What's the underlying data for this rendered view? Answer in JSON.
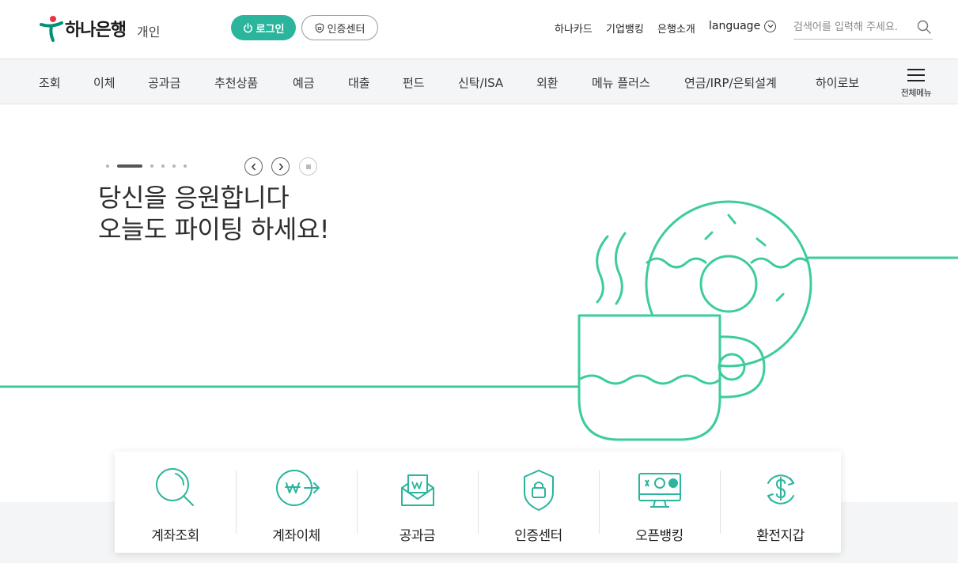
{
  "header": {
    "logo_text": "하나은행",
    "logo_sub": "개인",
    "login_label": "로그인",
    "cert_center_label": "인증센터",
    "util_links": [
      "하나카드",
      "기업뱅킹",
      "은행소개"
    ],
    "language_label": "language",
    "search_placeholder": "검색어를 입력해 주세요."
  },
  "nav": {
    "items": [
      "조회",
      "이체",
      "공과금",
      "추천상품",
      "예금",
      "대출",
      "펀드",
      "신탁/ISA",
      "외환",
      "메뉴 플러스",
      "연금/IRP/은퇴설계",
      "하이로보"
    ],
    "all_menu_label": "전체메뉴"
  },
  "hero": {
    "headline_line1": "당신을 응원합니다",
    "headline_line2": "오늘도 파이팅 하세요!",
    "slides_total": 6,
    "active_slide": 2
  },
  "quick_menu": [
    {
      "label": "계좌조회",
      "icon": "magnifier-icon"
    },
    {
      "label": "계좌이체",
      "icon": "won-transfer-icon"
    },
    {
      "label": "공과금",
      "icon": "bill-envelope-icon"
    },
    {
      "label": "인증센터",
      "icon": "lock-shield-icon"
    },
    {
      "label": "오픈뱅킹",
      "icon": "monitor-bank-icon"
    },
    {
      "label": "환전지갑",
      "icon": "dollar-exchange-icon"
    }
  ],
  "colors": {
    "accent": "#2ab59c",
    "illustration": "#3dcc9c",
    "logo_red": "#e8334a",
    "logo_green": "#009178"
  }
}
